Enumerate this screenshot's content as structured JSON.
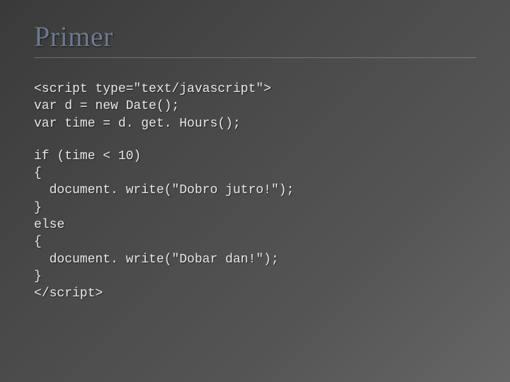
{
  "slide": {
    "title": "Primer",
    "code_block1_lines": [
      "<script type=\"text/javascript\">",
      "var d = new Date();",
      "var time = d. get. Hours();"
    ],
    "code_block2_lines": [
      "if (time < 10)",
      "{",
      "  document. write(\"Dobro jutro!\");",
      "}",
      "else",
      "{",
      "  document. write(\"Dobar dan!\");",
      "}",
      "</script>"
    ]
  }
}
